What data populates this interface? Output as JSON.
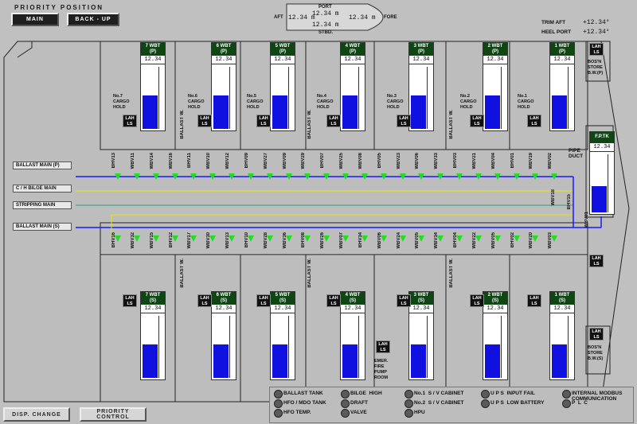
{
  "header": {
    "title": "PRIORITY   POSITION",
    "main_btn": "MAIN",
    "backup_btn": "BACK - UP"
  },
  "draft": {
    "port": "PORT",
    "stbd": "STBD.",
    "aft": "AFT",
    "fore": "FORE",
    "top": "12.34 m",
    "left": "12.34 m",
    "right": "12.34 m",
    "bottom": "12.34 m"
  },
  "trim": {
    "trim_label": "TRIM AFT",
    "trim_val": "+12.34°",
    "heel_label": "HEEL PORT",
    "heel_val": "+12.34°"
  },
  "tanks_port": [
    {
      "title": "7 WBT\n(P)",
      "level": "12.34",
      "fill": 0.42
    },
    {
      "title": "6 WBT\n(P)",
      "level": "12.34",
      "fill": 0.42
    },
    {
      "title": "5 WBT\n(P)",
      "level": "12.34",
      "fill": 0.42
    },
    {
      "title": "4 WBT\n(P)",
      "level": "12.34",
      "fill": 0.42
    },
    {
      "title": "3 WBT\n(P)",
      "level": "12.34",
      "fill": 0.42
    },
    {
      "title": "2 WBT\n(P)",
      "level": "12.34",
      "fill": 0.42
    },
    {
      "title": "1 WBT\n(P)",
      "level": "12.34",
      "fill": 0.42
    }
  ],
  "tanks_stbd": [
    {
      "title": "7 WBT\n(S)",
      "level": "12.34",
      "fill": 0.42
    },
    {
      "title": "6 WBT\n(S)",
      "level": "12.34",
      "fill": 0.42
    },
    {
      "title": "5 WBT\n(S)",
      "level": "12.34",
      "fill": 0.42
    },
    {
      "title": "4 WBT\n(S)",
      "level": "12.34",
      "fill": 0.42
    },
    {
      "title": "3 WBT\n(S)",
      "level": "12.34",
      "fill": 0.42
    },
    {
      "title": "2 WBT\n(S)",
      "level": "12.34",
      "fill": 0.42
    },
    {
      "title": "1 WBT\n(S)",
      "level": "12.34",
      "fill": 0.42
    }
  ],
  "fptk": {
    "title": "F.P.TK",
    "level": "12.34",
    "fill": 0.42
  },
  "holds": [
    "No.7\nCARGO\nHOLD",
    "No.6\nCARGO\nHOLD",
    "No.5\nCARGO\nHOLD",
    "No.4\nCARGO\nHOLD",
    "No.3\nCARGO\nHOLD",
    "No.2\nCARGO\nHOLD",
    "No.1\nCARGO\nHOLD"
  ],
  "ballast_w": "BALLAST W.",
  "bosn_p": "BOS'N\nSTORE\nB.W.(P)",
  "bosn_s": "BOS'N\nSTORE\nB.W.(S)",
  "pipe_duct": "PIPE\nDUCT",
  "emer": "EMER.\nFIRE\nPUMP\nROOM",
  "lah": "LAH\nLS",
  "lines": {
    "ballast_p": "BALLAST MAIN (P)",
    "bilge": "C / H BILGE MAIN",
    "stripping": "STRIPPING MAIN",
    "ballast_s": "BALLAST MAIN (S)"
  },
  "valves_top": [
    "BHV13",
    "WBV11",
    "WBV14",
    "WBV16",
    "BHV11",
    "WBV10",
    "WBV12",
    "BHV09",
    "WBV27",
    "WBV09",
    "WBV29",
    "BHV07",
    "WBV25",
    "WBV08",
    "BHV05",
    "WBV23",
    "WBV06",
    "WBV33",
    "BHV03",
    "WBV21",
    "WBV04",
    "BHV01",
    "WBV19",
    "WBV02"
  ],
  "valves_bot": [
    "BHV16",
    "WBV32",
    "WBV15",
    "BHV12",
    "WBV17",
    "WBV30",
    "WBV13",
    "BHV10",
    "WBV28",
    "WBV36",
    "BHV08",
    "WBV26",
    "WBV07",
    "BHV34",
    "WBV06",
    "WBV24",
    "WBV05",
    "WBV34",
    "BHV04",
    "WBV22",
    "WBV05",
    "BHV02",
    "WBV20",
    "WBV03"
  ],
  "valves_fore": [
    "WBV18",
    "BHV15",
    "WBV01"
  ],
  "footer": {
    "disp": "DISP. CHANGE",
    "priority": "PRIORITY\nCONTROL"
  },
  "legend": [
    {
      "label": "BALLAST TANK"
    },
    {
      "label": "BILGE  HIGH"
    },
    {
      "label": "No.1  S / V CABINET"
    },
    {
      "label": "U P S  INPUT FAIL"
    },
    {
      "label": "INTERNAL MODBUS\nCOMMUNICATION"
    },
    {
      "label": "HFO / MDO TANK"
    },
    {
      "label": "DRAFT"
    },
    {
      "label": "No.2  S / V CABINET"
    },
    {
      "label": "U P S  LOW BATTERY"
    },
    {
      "label": "P  L  C"
    },
    {
      "label": "HFO TEMP."
    },
    {
      "label": "VALVE"
    },
    {
      "label": "HPU"
    }
  ],
  "colors": {
    "tank_fill": "#1010e0",
    "tank_header": "#0e4614",
    "ballast_line": "#1a1aff",
    "bilge_line": "#e8e800",
    "strip_line": "#2aa088",
    "valve": "#22dd22"
  }
}
